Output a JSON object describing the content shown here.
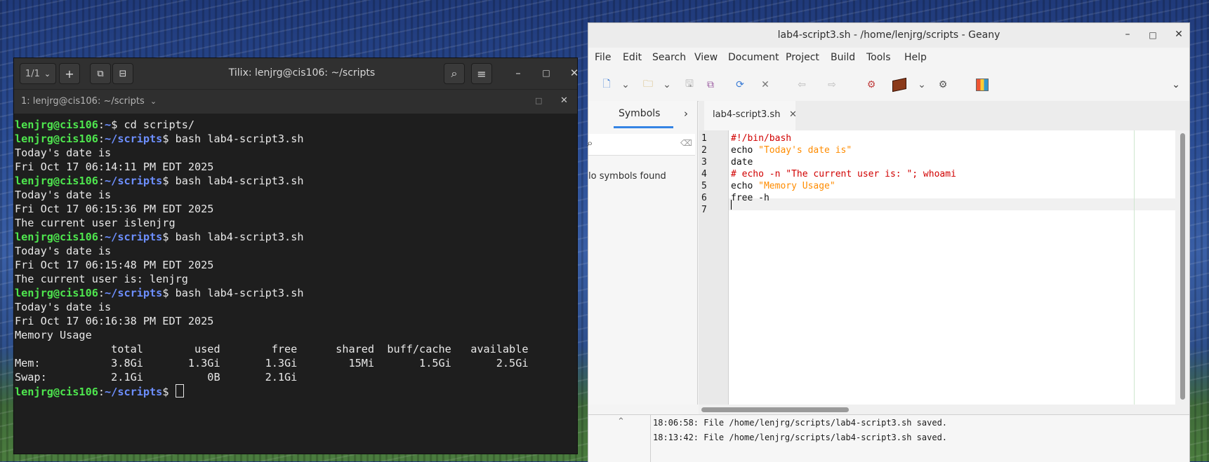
{
  "tilix": {
    "tab_counter": "1/1",
    "title": "Tilix: lenjrg@cis106: ~/scripts",
    "session_title": "1: lenjrg@cis106: ~/scripts",
    "prompt_user": "lenjrg@cis106",
    "lines": [
      {
        "type": "prompt",
        "path": "~",
        "cmd": "$ cd scripts/"
      },
      {
        "type": "prompt",
        "path": "~/scripts",
        "cmd": "$ bash lab4-script3.sh"
      },
      {
        "type": "out",
        "text": "Today's date is"
      },
      {
        "type": "out",
        "text": "Fri Oct 17 06:14:11 PM EDT 2025"
      },
      {
        "type": "prompt",
        "path": "~/scripts",
        "cmd": "$ bash lab4-script3.sh"
      },
      {
        "type": "out",
        "text": "Today's date is"
      },
      {
        "type": "out",
        "text": "Fri Oct 17 06:15:36 PM EDT 2025"
      },
      {
        "type": "out",
        "text": "The current user islenjrg"
      },
      {
        "type": "prompt",
        "path": "~/scripts",
        "cmd": "$ bash lab4-script3.sh"
      },
      {
        "type": "out",
        "text": "Today's date is"
      },
      {
        "type": "out",
        "text": "Fri Oct 17 06:15:48 PM EDT 2025"
      },
      {
        "type": "out",
        "text": "The current user is: lenjrg"
      },
      {
        "type": "prompt",
        "path": "~/scripts",
        "cmd": "$ bash lab4-script3.sh"
      },
      {
        "type": "out",
        "text": "Today's date is"
      },
      {
        "type": "out",
        "text": "Fri Oct 17 06:16:38 PM EDT 2025"
      },
      {
        "type": "out",
        "text": "Memory Usage"
      },
      {
        "type": "out",
        "text": "               total        used        free      shared  buff/cache   available"
      },
      {
        "type": "out",
        "text": "Mem:           3.8Gi       1.3Gi       1.3Gi        15Mi       1.5Gi       2.5Gi"
      },
      {
        "type": "out",
        "text": "Swap:          2.1Gi          0B       2.1Gi"
      },
      {
        "type": "prompt",
        "path": "~/scripts",
        "cmd": "$ ",
        "cursor": true
      }
    ]
  },
  "geany": {
    "title": "lab4-script3.sh - /home/lenjrg/scripts - Geany",
    "menu": [
      "File",
      "Edit",
      "Search",
      "View",
      "Document",
      "Project",
      "Build",
      "Tools",
      "Help"
    ],
    "sidebar_tab": "Symbols",
    "no_symbols": "lo symbols found",
    "editor_tab": "lab4-script3.sh",
    "code": [
      {
        "num": "1",
        "text": "#!/bin/bash",
        "kind": "cmt"
      },
      {
        "num": "2",
        "pre": "echo ",
        "str": "\"Today's date is\""
      },
      {
        "num": "3",
        "text": "date"
      },
      {
        "num": "4",
        "text": "# echo -n \"The current user is: \"; whoami",
        "kind": "cmt"
      },
      {
        "num": "5",
        "pre": "echo ",
        "str": "\"Memory Usage\""
      },
      {
        "num": "6",
        "text": "free -h"
      },
      {
        "num": "7",
        "text": ""
      }
    ],
    "messages": [
      "18:06:58: File /home/lenjrg/scripts/lab4-script3.sh saved.",
      "18:13:42: File /home/lenjrg/scripts/lab4-script3.sh saved."
    ]
  }
}
